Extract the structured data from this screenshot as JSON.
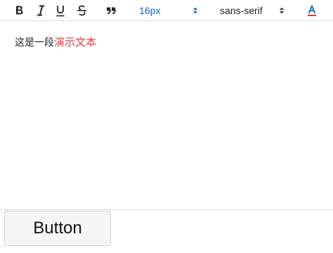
{
  "toolbar": {
    "bold_icon": "bold-icon",
    "italic_icon": "italic-icon",
    "underline_icon": "underline-icon",
    "strike_icon": "strikethrough-icon",
    "quote_icon": "blockquote-icon",
    "size_value": "16px",
    "family_value": "sans-serif",
    "color_icon": "font-color-icon",
    "accent_color": "#1565c0",
    "font_color_bar": "#e53935"
  },
  "editor": {
    "text_plain": "这是一段",
    "text_red": "演示文本",
    "red_color": "#e53935"
  },
  "footer": {
    "button_label": "Button"
  }
}
